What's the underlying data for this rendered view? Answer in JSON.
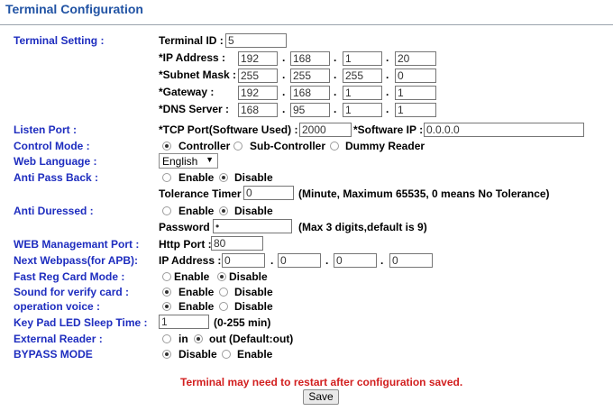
{
  "page": {
    "title": "Terminal Configuration"
  },
  "labels": {
    "terminal_setting": "Terminal Setting :",
    "listen_port": "Listen Port :",
    "control_mode": "Control Mode :",
    "web_language": "Web Language :",
    "anti_pass_back": "Anti Pass Back :",
    "anti_duressed": "Anti Duressed :",
    "web_port": "WEB Managemant Port :",
    "next_webpass": "Next Webpass(for APB):",
    "fast_reg": "Fast Reg Card Mode :",
    "sound_verify": "Sound for verify card :",
    "operation_voice": "operation voice :",
    "keypad": "Key Pad LED Sleep Time :",
    "external_reader": "External Reader :",
    "bypass": "BYPASS MODE"
  },
  "terminal": {
    "id_label": "Terminal ID :",
    "id_value": "5",
    "ip_label": "*IP Address :",
    "ip": [
      "192",
      "168",
      "1",
      "20"
    ],
    "mask_label": "*Subnet Mask :",
    "mask": [
      "255",
      "255",
      "255",
      "0"
    ],
    "gw_label": "*Gateway :",
    "gw": [
      "192",
      "168",
      "1",
      "1"
    ],
    "dns_label": "*DNS Server :",
    "dns": [
      "168",
      "95",
      "1",
      "1"
    ],
    "dot": "."
  },
  "listen": {
    "tcp_label": "*TCP Port(Software Used) :",
    "tcp_value": "2000",
    "sw_ip_label": "*Software IP :",
    "sw_ip_value": "0.0.0.0"
  },
  "control_mode": {
    "controller": "Controller",
    "sub": "Sub-Controller",
    "dummy": "Dummy Reader",
    "selected": "Controller"
  },
  "web_language": {
    "selected": "English"
  },
  "anti_pass_back": {
    "enable": "Enable",
    "disable": "Disable",
    "selected": "Disable",
    "tol_label": "Tolerance Timer",
    "tol_value": "0",
    "tol_hint": "(Minute, Maximum 65535, 0 means No Tolerance)"
  },
  "anti_duressed": {
    "enable": "Enable",
    "disable": "Disable",
    "selected": "Disable",
    "pw_label": "Password",
    "pw_value": "•",
    "pw_hint": "(Max 3 digits,default is 9)"
  },
  "web_port": {
    "label": "Http Port :",
    "value": "80"
  },
  "next_webpass": {
    "label": "IP Address :",
    "ip": [
      "0",
      "0",
      "0",
      "0"
    ]
  },
  "fast_reg": {
    "enable": "Enable",
    "disable": "Disable",
    "selected": "Disable"
  },
  "sound_verify": {
    "enable": "Enable",
    "disable": "Disable",
    "selected": "Enable"
  },
  "operation_voice": {
    "enable": "Enable",
    "disable": "Disable",
    "selected": "Enable"
  },
  "keypad": {
    "value": "1",
    "hint": "(0-255 min)"
  },
  "external_reader": {
    "in": "in",
    "out": "out (Default:out)",
    "selected": "out"
  },
  "bypass": {
    "disable": "Disable",
    "enable": "Enable",
    "selected": "Disable"
  },
  "footer": {
    "warning": "Terminal may need to restart after configuration saved.",
    "save": "Save"
  }
}
